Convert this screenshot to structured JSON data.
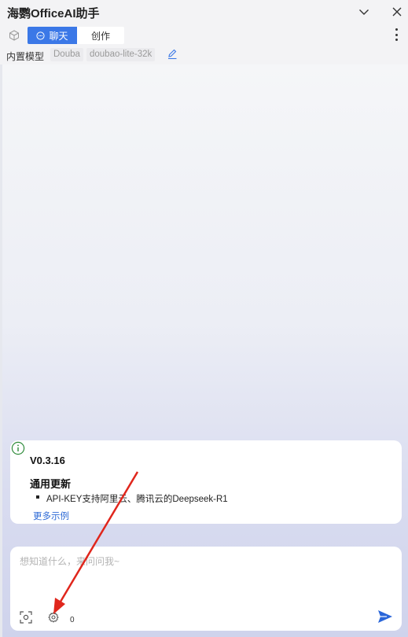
{
  "app": {
    "title": "海鹦OfficeAI助手"
  },
  "tabs": [
    {
      "label": "聊天",
      "active": true,
      "icon": "chat-bubble-icon"
    },
    {
      "label": "创作",
      "active": false
    }
  ],
  "model": {
    "label": "内置模型",
    "provider": "Douba",
    "name": "doubao-lite-32k"
  },
  "notice": {
    "version": "V0.3.16",
    "section_title": "通用更新",
    "items": [
      "API-KEY支持阿里云、腾讯云的Deepseek-R1"
    ],
    "more_link": "更多示例"
  },
  "input": {
    "placeholder": "想知道什么，来问问我~",
    "value": "",
    "count": "0"
  },
  "colors": {
    "accent": "#3b78e7",
    "link": "#2f6bd6",
    "annotation_arrow": "#e0261c",
    "info_icon": "#2e8b3a"
  },
  "icons": [
    "chevron-down-icon",
    "close-icon",
    "cube-icon",
    "chat-bubble-icon",
    "more-vertical-icon",
    "edit-icon",
    "info-icon",
    "scan-icon",
    "gear-icon",
    "send-icon"
  ]
}
